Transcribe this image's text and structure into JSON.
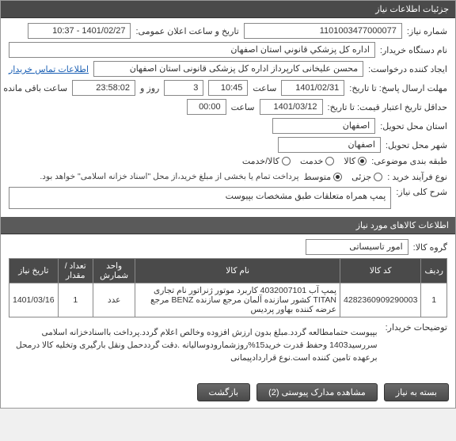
{
  "header": {
    "title": "جزئیات اطلاعات نیاز"
  },
  "req": {
    "number_label": "شماره نیاز:",
    "number": "1101003477000077",
    "announce_label": "تاریخ و ساعت اعلان عمومی:",
    "announce": "1401/02/27 - 10:37",
    "buyer_label": "نام دستگاه خریدار:",
    "buyer": "اداره كل پزشكي قانوني استان اصفهان",
    "creator_label": "ایجاد کننده درخواست:",
    "creator": "محسن علیخانی کارپرداز اداره کل پزشکی قانونی استان اصفهان",
    "contact_link": "اطلاعات تماس خریدار",
    "deadline_label": "مهلت ارسال پاسخ: تا تاریخ:",
    "deadline_date": "1401/02/31",
    "deadline_time_label": "ساعت",
    "deadline_time": "10:45",
    "days_label": "روز و",
    "days": "3",
    "remain_time": "23:58:02",
    "remain_label": "ساعت باقی مانده",
    "validity_label": "حداقل تاریخ اعتبار قیمت: تا تاریخ:",
    "validity_date": "1401/03/12",
    "validity_time": "00:00",
    "req_city_label": "استان محل تحویل:",
    "req_city": "اصفهان",
    "del_city_label": "شهر محل تحویل:",
    "del_city": "اصفهان",
    "category_label": "طبقه بندی موضوعی:",
    "cat_goods": "کالا",
    "cat_service": "خدمت",
    "cat_both": "کالا/خدمت",
    "process_label": "نوع فرآیند خرید :",
    "proc_minor": "جزئی",
    "proc_medium": "متوسط",
    "payment_note": "پرداخت تمام یا بخشی از مبلغ خرید،از محل \"اسناد خزانه اسلامی\" خواهد بود.",
    "desc_label": "شرح کلی نیاز:",
    "desc": "پمپ همراه متعلقات طبق مشخصات بپیوست"
  },
  "items_header": {
    "title": "اطلاعات کالاهای مورد نیاز",
    "group_label": "گروه کالا:",
    "group": "امور تاسیساتی"
  },
  "table": {
    "headers": {
      "row": "ردیف",
      "code": "کد کالا",
      "name": "نام کالا",
      "unit": "واحد شمارش",
      "qty": "تعداد / مقدار",
      "date": "تاریخ نیاز"
    },
    "rows": [
      {
        "idx": "1",
        "code": "4282360909290003",
        "name": "پمپ آب 4032007101 کاربرد موتور ژنراتور نام تجاری TITAN کشور سازنده آلمان مرجع سازنده BENZ مرجع عرضه کننده بهاور پردیس",
        "unit": "عدد",
        "qty": "1",
        "date": "1401/03/16"
      }
    ]
  },
  "remarks": {
    "label": "توضیحات خریدار:",
    "text": "بپیوست حتمامطالعه گردد.مبلغ بدون ارزش افزوده وخالص اعلام گردد.پرداخت بااسنادخزانه اسلامی سررسید1403 وحفظ قدرت خرید15%روزشمارودوسالیانه .دقت گرددحمل ونقل بارگیری وتخلیه کالا درمحل برعهده تامین کننده است.نوع قراردادپیمانی"
  },
  "buttons": {
    "back": "بسته به نیاز",
    "attachments": "مشاهده مدارک پیوستی (2)",
    "goback": "بازگشت"
  }
}
